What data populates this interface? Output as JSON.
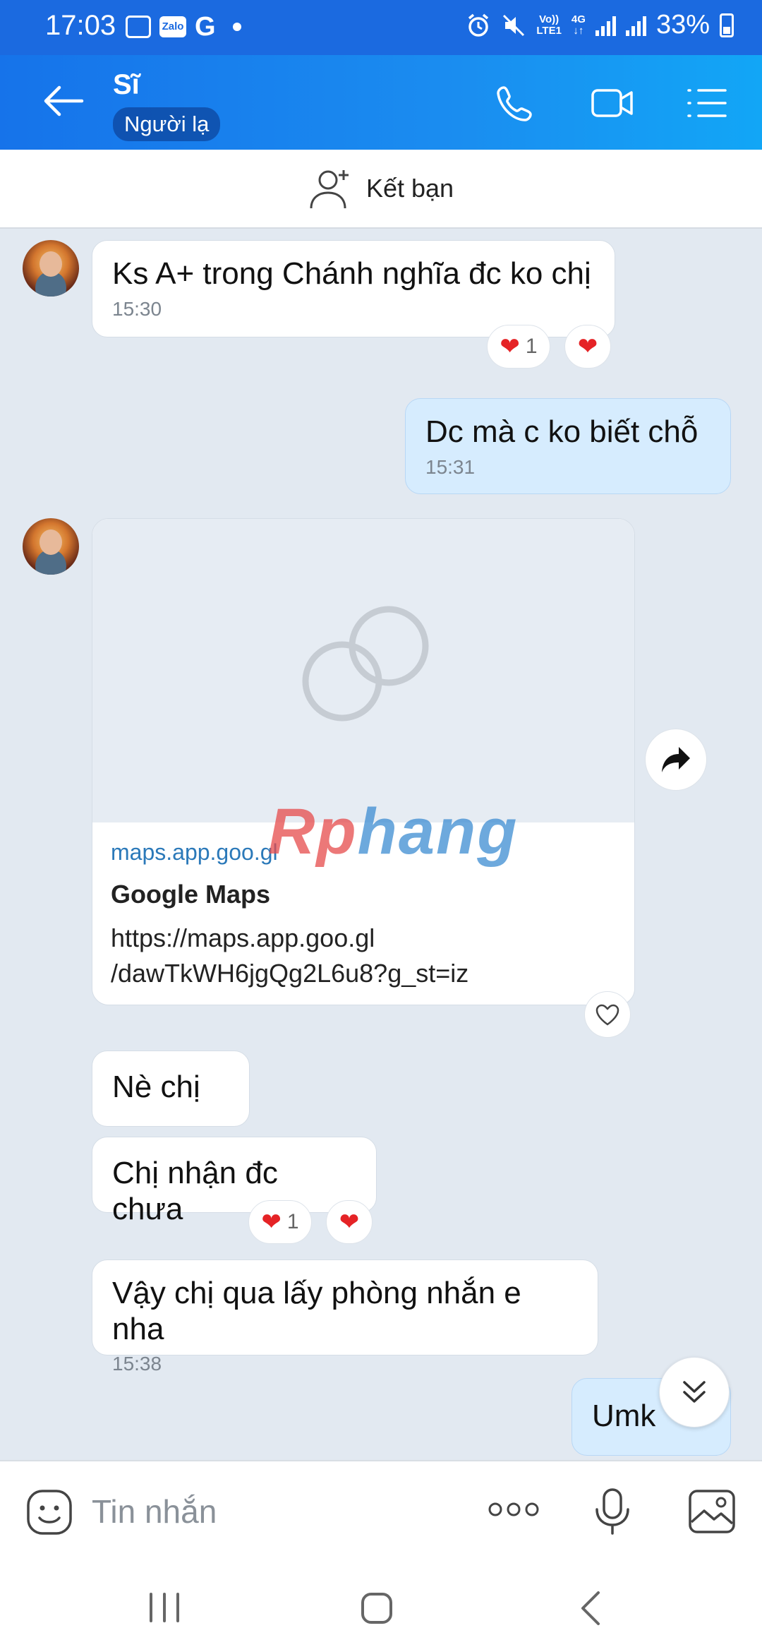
{
  "status_bar": {
    "time": "17:03",
    "zalo": "Zalo",
    "g": "G",
    "net_vo": "Vo))",
    "net_lte": "LTE1",
    "net_4g": "4G",
    "battery": "33%"
  },
  "header": {
    "title": "Sĩ",
    "badge": "Người lạ"
  },
  "friend_bar": {
    "label": "Kết bạn"
  },
  "messages": {
    "m1": {
      "text": "Ks A+ trong Chánh nghĩa đc ko chị",
      "time": "15:30",
      "reaction_count": "1"
    },
    "m2": {
      "text": "Dc mà c ko biết  chỗ",
      "time": "15:31"
    },
    "link": {
      "domain": "maps.app.goo.gl",
      "title": "Google Maps",
      "url_line1": "https://maps.app.goo.gl",
      "url_line2": "/dawTkWH6jgQg2L6u8?g_st=iz"
    },
    "m3": {
      "text": "Nè chị"
    },
    "m4": {
      "text": "Chị nhận đc chưa",
      "reaction_count": "1"
    },
    "m5": {
      "text": "Vậy chị qua lấy phòng nhắn e nha",
      "time": "15:38"
    },
    "m6": {
      "text": "Umk"
    }
  },
  "watermark": {
    "part1": "Rp",
    "part2": "hang"
  },
  "input": {
    "placeholder": "Tin nhắn"
  },
  "colors": {
    "header_start": "#1673ea",
    "header_end": "#12a6f6",
    "my_bubble": "#d6ecfe",
    "heart": "#e52326",
    "link_domain": "#2b79b9"
  }
}
